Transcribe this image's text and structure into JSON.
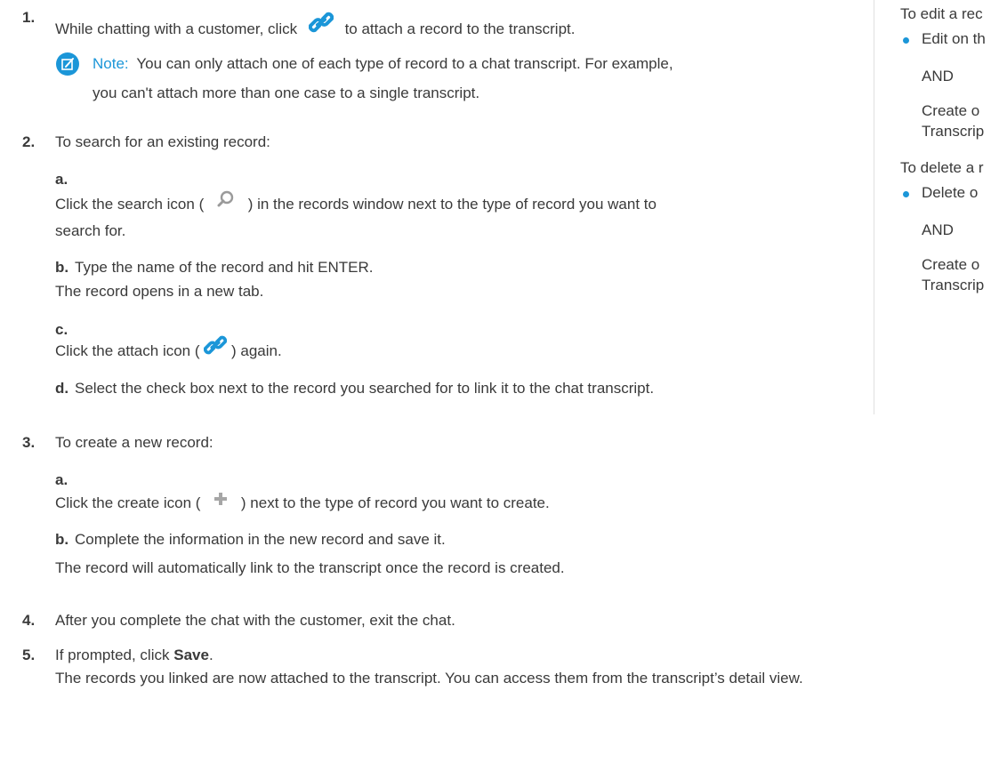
{
  "steps": {
    "s1": {
      "num": "1.",
      "text": "While chatting with a customer, click",
      "text_after": "to attach a record to the transcript."
    },
    "note": {
      "label": "Note:",
      "line1": "You can only attach one of each type of record to a chat transcript. For example,",
      "line2": "you can't attach more than one case to a single transcript."
    },
    "s2": {
      "num": "2.",
      "text": "To search for an existing record:",
      "a": {
        "letter": "a.",
        "pre": "Click the search icon (",
        "post": ") in the records window next to the type of record you want to",
        "line2": "search for."
      },
      "b": {
        "letter": "b.",
        "line1": "Type the name of the record and hit ENTER.",
        "line2": "The record opens in a new tab."
      },
      "c": {
        "letter": "c.",
        "pre": "Click the attach icon (",
        "post": ") again."
      },
      "d": {
        "letter": "d.",
        "text": "Select the check box next to the record you searched for to link it to the chat transcript."
      }
    },
    "s3": {
      "num": "3.",
      "text": "To create a new record:",
      "a": {
        "letter": "a.",
        "pre": "Click the create icon (",
        "post": ") next to the type of record you want to create."
      },
      "b": {
        "letter": "b.",
        "line1": "Complete the information in the new record and save it.",
        "line2": "The record will automatically link to the transcript once the record is created."
      }
    },
    "s4": {
      "num": "4.",
      "text": "After you complete the chat with the customer, exit the chat."
    },
    "s5": {
      "num": "5.",
      "pre": "If prompted, click",
      "bold": "Save",
      "post": ".",
      "line2": "The records you linked are now attached to the transcript. You can access them from the transcript’s detail view."
    }
  },
  "sidebar": {
    "edit_heading": "To edit a rec",
    "edit_bullet": "Edit on th",
    "edit_and": "AND",
    "edit_create1": "Create o",
    "edit_create2": "Transcrip",
    "delete_heading": "To delete a r",
    "delete_bullet": "Delete o",
    "delete_and": "AND",
    "delete_create1": "Create o",
    "delete_create2": "Transcrip"
  },
  "icons": {
    "attach": "attach-link-icon",
    "note": "note-edit-icon",
    "search": "search-icon",
    "create": "plus-icon"
  },
  "colors": {
    "accent": "#1b96d8",
    "text": "#3a3a3a"
  }
}
